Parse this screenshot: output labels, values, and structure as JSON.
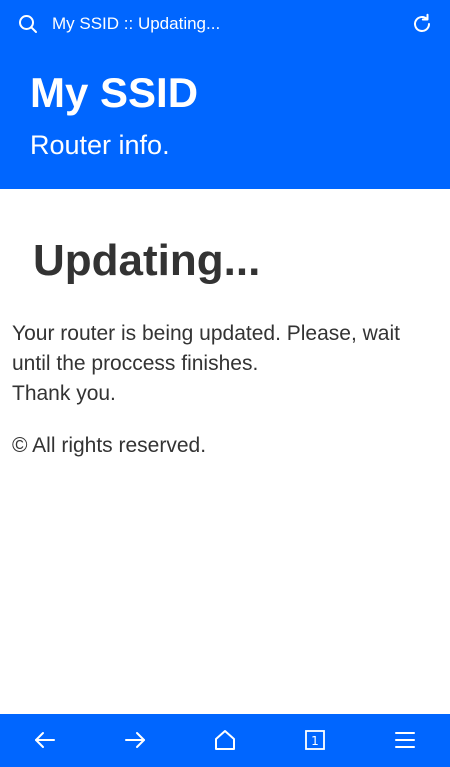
{
  "browser": {
    "url_title": "My SSID :: Updating...",
    "search_icon": "search-icon",
    "refresh_icon": "refresh-icon"
  },
  "header": {
    "title": "My SSID",
    "subtitle": "Router info."
  },
  "main": {
    "heading": "Updating...",
    "message_lines": [
      "Your router is being updated. Please, wait",
      "until the proccess finishes.",
      "Thank you."
    ],
    "copyright": "© All rights reserved."
  },
  "nav": {
    "items": [
      "back-icon",
      "forward-icon",
      "home-icon",
      "tabs-icon",
      "menu-icon"
    ],
    "tab_count": "1"
  },
  "colors": {
    "brand_blue": "#0066ff",
    "text": "#333333",
    "background": "#ffffff"
  }
}
